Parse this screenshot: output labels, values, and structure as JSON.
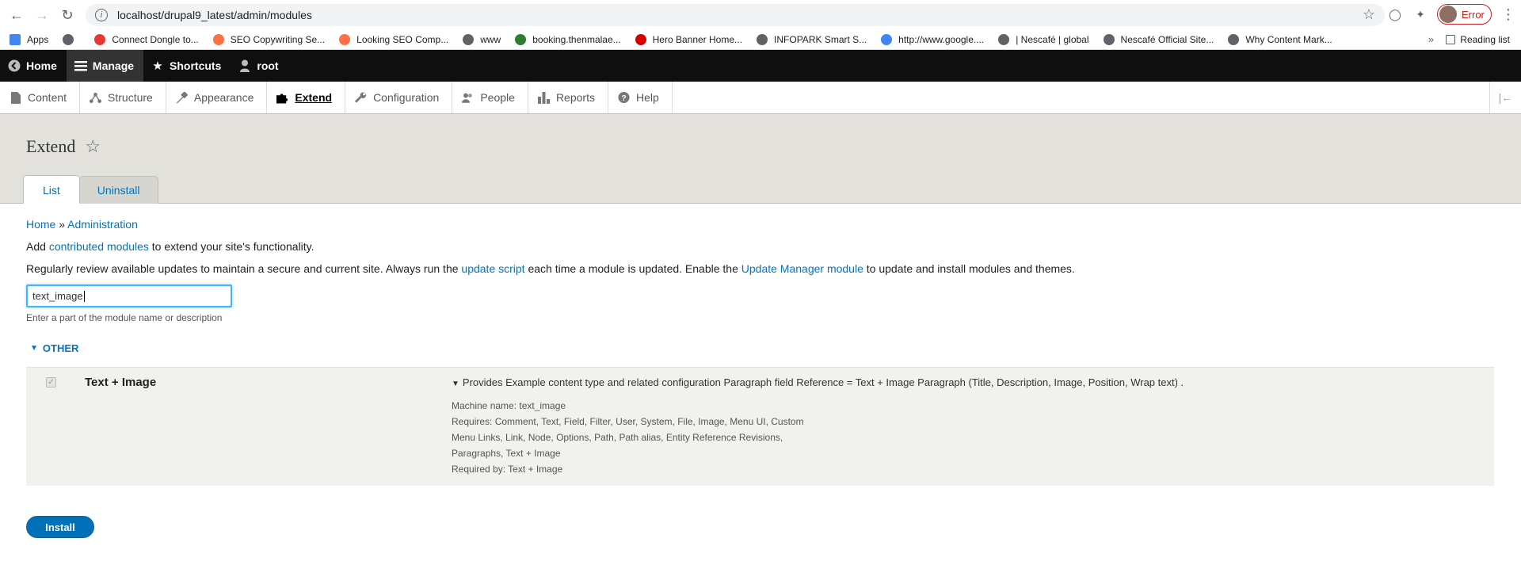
{
  "browser": {
    "url": "localhost/drupal9_latest/admin/modules",
    "error_label": "Error",
    "reading_list": "Reading list",
    "more": "»",
    "bookmarks": [
      {
        "label": "Apps",
        "color": "#4285f4"
      },
      {
        "label": "",
        "color": "#5f6368"
      },
      {
        "label": "Connect Dongle to...",
        "color": "#e53935"
      },
      {
        "label": "SEO Copywriting Se...",
        "color": "#ff7043"
      },
      {
        "label": "Looking SEO Comp...",
        "color": "#ff7043"
      },
      {
        "label": "www",
        "color": "#5f6368"
      },
      {
        "label": "booking.thenmalae...",
        "color": "#2e7d32"
      },
      {
        "label": "Hero Banner Home...",
        "color": "#d50000"
      },
      {
        "label": "INFOPARK Smart S...",
        "color": "#5f6368"
      },
      {
        "label": "http://www.google....",
        "color": "#4285f4"
      },
      {
        "label": "| Nescafé | global",
        "color": "#5f6368"
      },
      {
        "label": "Nescafé Official Site...",
        "color": "#5f6368"
      },
      {
        "label": "Why Content Mark...",
        "color": "#5f6368"
      }
    ]
  },
  "toolbar": {
    "items": [
      {
        "label": "Home",
        "icon": "drupal-back-icon"
      },
      {
        "label": "Manage",
        "icon": "menu-icon"
      },
      {
        "label": "Shortcuts",
        "icon": "star-icon"
      },
      {
        "label": "root",
        "icon": "user-icon"
      }
    ],
    "tray": [
      {
        "label": "Content",
        "icon": "file-icon"
      },
      {
        "label": "Structure",
        "icon": "structure-icon"
      },
      {
        "label": "Appearance",
        "icon": "paint-icon"
      },
      {
        "label": "Extend",
        "icon": "puzzle-icon"
      },
      {
        "label": "Configuration",
        "icon": "wrench-icon"
      },
      {
        "label": "People",
        "icon": "people-icon"
      },
      {
        "label": "Reports",
        "icon": "bar-chart-icon"
      },
      {
        "label": "Help",
        "icon": "help-icon"
      }
    ]
  },
  "page": {
    "title": "Extend",
    "tabs": [
      "List",
      "Uninstall"
    ],
    "breadcrumb": {
      "home": "Home",
      "sep": "»",
      "admin": "Administration"
    },
    "intro": {
      "pre": "Add ",
      "link": "contributed modules",
      "post": " to extend your site's functionality."
    },
    "review": {
      "pre": "Regularly review available updates to maintain a secure and current site. Always run the ",
      "link1": "update script",
      "mid": " each time a module is updated. Enable the ",
      "link2": "Update Manager module",
      "post": " to update and install modules and themes."
    },
    "filter": {
      "value": "text_image",
      "help": "Enter a part of the module name or description"
    },
    "group": "OTHER",
    "module": {
      "name": "Text + Image",
      "description": "Provides Example content type and related configuration Paragraph field Reference = Text + Image Paragraph (Title, Description, Image, Position, Wrap text) .",
      "machine_name": "Machine name: text_image",
      "requires_1": "Requires: Comment, Text, Field, Filter, User, System, File, Image, Menu UI, Custom",
      "requires_2": "Menu Links, Link, Node, Options, Path, Path alias, Entity Reference Revisions,",
      "requires_3": "Paragraphs, Text + Image",
      "required_by": "Required by: Text + Image"
    },
    "install": "Install"
  },
  "colors": {
    "link": "#0074bd",
    "toolbar": "#0f0f0f",
    "header_bg": "#e2e1dc",
    "install_btn": "#0071b8"
  }
}
